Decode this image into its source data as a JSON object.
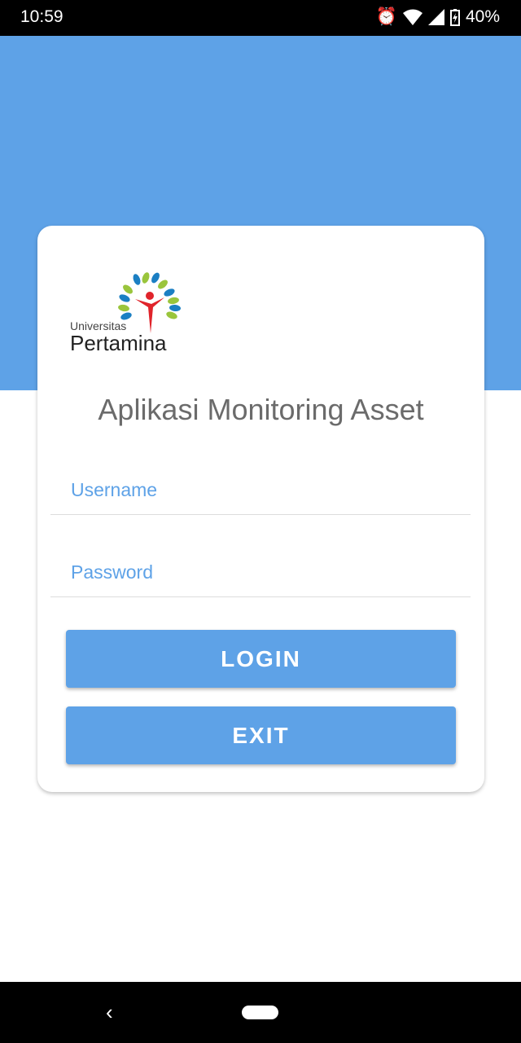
{
  "status_bar": {
    "time": "10:59",
    "battery": "40%",
    "icons": [
      "alarm-icon",
      "wifi-icon",
      "signal-icon",
      "battery-charging-icon"
    ]
  },
  "logo": {
    "line1": "Universitas",
    "line2": "Pertamina"
  },
  "app_title": "Aplikasi Monitoring Asset",
  "form": {
    "username_placeholder": "Username",
    "password_placeholder": "Password",
    "username_value": "",
    "password_value": ""
  },
  "buttons": {
    "login": "LOGIN",
    "exit": "EXIT"
  },
  "colors": {
    "primary": "#5ea2e7"
  },
  "nav": {
    "icons": [
      "back-icon",
      "home-pill"
    ]
  }
}
